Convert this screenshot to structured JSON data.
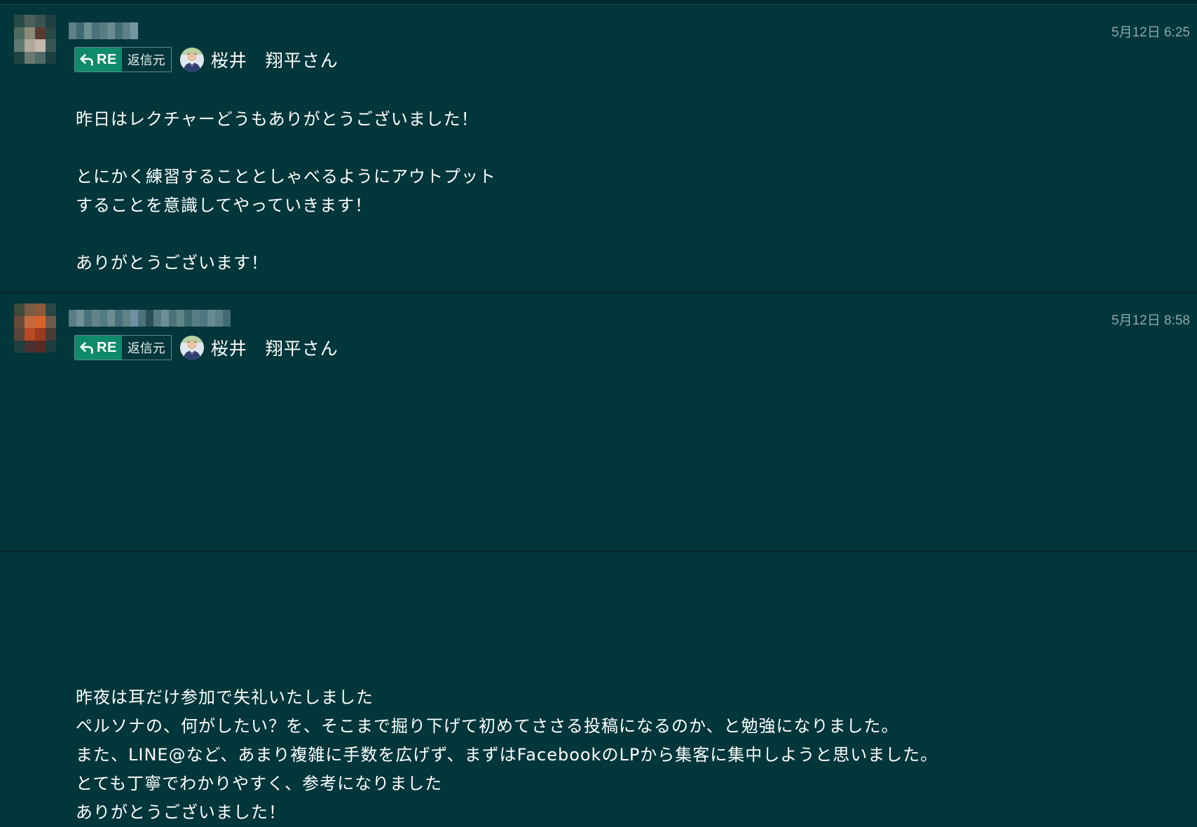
{
  "messages": [
    {
      "timestamp": "5月12日 6:25",
      "reply": {
        "badge_label": "RE",
        "source_label": "返信元",
        "to_name": "桜井　翔平さん"
      },
      "lines": [
        "昨日はレクチャーどうもありがとうございました！",
        "",
        "とにかく練習することとしゃべるようにアウトプット",
        "することを意識してやっていきます！",
        "",
        "ありがとうございます！"
      ]
    },
    {
      "timestamp": "5月12日 8:58",
      "reply": {
        "badge_label": "RE",
        "source_label": "返信元",
        "to_name": "桜井　翔平さん"
      },
      "lines": [
        "昨夜は耳だけ参加で失礼いたしました",
        "ペルソナの、何がしたい？を、そこまで掘り下げて初めてささる投稿になるのか、と勉強になりました。",
        "また、LINE@など、あまり複雑に手数を広げず、まずはFacebookのLPから集客に集中しようと思いました。",
        "とても丁寧でわかりやすく、参考になりました",
        "ありがとうございました！"
      ]
    }
  ],
  "colors": {
    "background": "#01363a",
    "re_badge": "#0f8a6a",
    "timestamp": "#8fa7a8"
  },
  "icons": {
    "reply": "reply-arrow-icon"
  }
}
